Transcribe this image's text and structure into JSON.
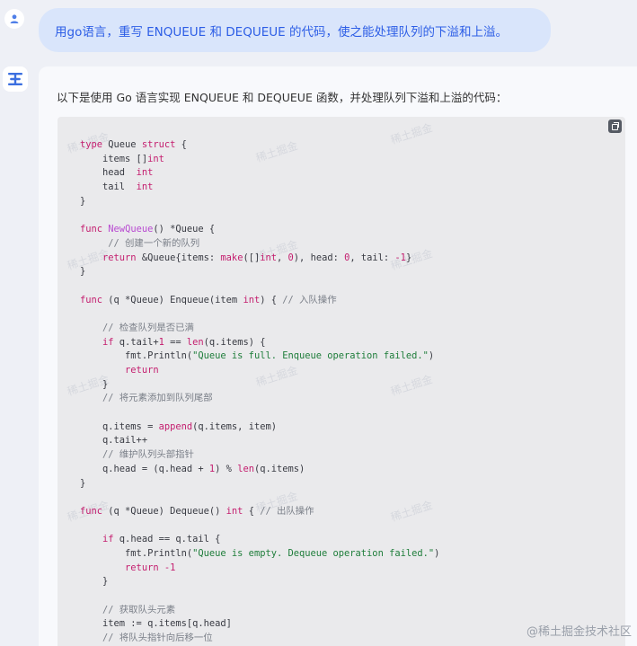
{
  "conversation": {
    "user_message": "用go语言，重写 ENQUEUE 和 DEQUEUE 的代码，使之能处理队列的下溢和上溢。",
    "bot_intro": "以下是使用 Go 语言实现 ENQUEUE 和 DEQUEUE 函数，并处理队列下溢和上溢的代码：",
    "code_lines": [
      [
        [
          "kw",
          "type"
        ],
        [
          "pl",
          " Queue "
        ],
        [
          "kw",
          "struct"
        ],
        [
          "pl",
          " {"
        ]
      ],
      [
        [
          "pl",
          "    items []"
        ],
        [
          "ty",
          "int"
        ]
      ],
      [
        [
          "pl",
          "    head  "
        ],
        [
          "ty",
          "int"
        ]
      ],
      [
        [
          "pl",
          "    tail  "
        ],
        [
          "ty",
          "int"
        ]
      ],
      [
        [
          "pl",
          "}"
        ]
      ],
      [],
      [
        [
          "kw",
          "func"
        ],
        [
          "pl",
          " "
        ],
        [
          "fn",
          "NewQueue"
        ],
        [
          "pl",
          "() *Queue {"
        ]
      ],
      [
        [
          "cm",
          "     // 创建一个新的队列"
        ]
      ],
      [
        [
          "pl",
          "    "
        ],
        [
          "kw",
          "return"
        ],
        [
          "pl",
          " &Queue{items: "
        ],
        [
          "bi",
          "make"
        ],
        [
          "pl",
          "([]"
        ],
        [
          "ty",
          "int"
        ],
        [
          "pl",
          ", "
        ],
        [
          "num",
          "0"
        ],
        [
          "pl",
          "), head: "
        ],
        [
          "num",
          "0"
        ],
        [
          "pl",
          ", tail: "
        ],
        [
          "num",
          "-1"
        ],
        [
          "pl",
          "}"
        ]
      ],
      [
        [
          "pl",
          "}"
        ]
      ],
      [],
      [
        [
          "kw",
          "func"
        ],
        [
          "pl",
          " (q *Queue) Enqueue(item "
        ],
        [
          "ty",
          "int"
        ],
        [
          "pl",
          ") { "
        ],
        [
          "cm",
          "// 入队操作"
        ]
      ],
      [],
      [
        [
          "cm",
          "    // 检查队列是否已满"
        ]
      ],
      [
        [
          "pl",
          "    "
        ],
        [
          "kw",
          "if"
        ],
        [
          "pl",
          " q.tail+"
        ],
        [
          "num",
          "1"
        ],
        [
          "pl",
          " == "
        ],
        [
          "bi",
          "len"
        ],
        [
          "pl",
          "(q.items) {"
        ]
      ],
      [
        [
          "pl",
          "        fmt.Println("
        ],
        [
          "str",
          "\"Queue is full. Enqueue operation failed.\""
        ],
        [
          "pl",
          ")"
        ]
      ],
      [
        [
          "pl",
          "        "
        ],
        [
          "kw",
          "return"
        ]
      ],
      [
        [
          "pl",
          "    }"
        ]
      ],
      [
        [
          "cm",
          "    // 将元素添加到队列尾部"
        ]
      ],
      [],
      [
        [
          "pl",
          "    q.items = "
        ],
        [
          "bi",
          "append"
        ],
        [
          "pl",
          "(q.items, item)"
        ]
      ],
      [
        [
          "pl",
          "    q.tail++"
        ]
      ],
      [
        [
          "cm",
          "    // 维护队列头部指针"
        ]
      ],
      [
        [
          "pl",
          "    q.head = (q.head + "
        ],
        [
          "num",
          "1"
        ],
        [
          "pl",
          ") % "
        ],
        [
          "bi",
          "len"
        ],
        [
          "pl",
          "(q.items)"
        ]
      ],
      [
        [
          "pl",
          "}"
        ]
      ],
      [],
      [
        [
          "kw",
          "func"
        ],
        [
          "pl",
          " (q *Queue) Dequeue() "
        ],
        [
          "ty",
          "int"
        ],
        [
          "pl",
          " { "
        ],
        [
          "cm",
          "// 出队操作"
        ]
      ],
      [],
      [
        [
          "pl",
          "    "
        ],
        [
          "kw",
          "if"
        ],
        [
          "pl",
          " q.head == q.tail {"
        ]
      ],
      [
        [
          "pl",
          "        fmt.Println("
        ],
        [
          "str",
          "\"Queue is empty. Dequeue operation failed.\""
        ],
        [
          "pl",
          ")"
        ]
      ],
      [
        [
          "pl",
          "        "
        ],
        [
          "kw",
          "return"
        ],
        [
          "pl",
          " "
        ],
        [
          "num",
          "-1"
        ]
      ],
      [
        [
          "pl",
          "    }"
        ]
      ],
      [],
      [
        [
          "cm",
          "    // 获取队头元素"
        ]
      ],
      [
        [
          "pl",
          "    item := q.items[q.head]"
        ]
      ],
      [
        [
          "cm",
          "    // 将队头指针向后移一位"
        ]
      ]
    ]
  },
  "watermarks": [
    "稀土掘金",
    "稀土掘金",
    "稀土掘金",
    "稀土掘金",
    "稀土掘金",
    "稀土掘金",
    "稀土掘金",
    "稀土掘金",
    "稀土掘金",
    "稀土掘金",
    "稀土掘金",
    "稀土掘金"
  ],
  "footer_watermark": "@稀土掘金技术社区",
  "icons": {
    "user_avatar": "user-icon",
    "bot_avatar": "bot-logo-icon",
    "copy": "copy-icon"
  },
  "colors": {
    "user_bubble_bg": "#d9e5fb",
    "user_text": "#2d5ee6",
    "keyword": "#c41d6e",
    "string": "#1e7d3a",
    "function": "#b84ad1",
    "comment": "#7a7f88"
  }
}
